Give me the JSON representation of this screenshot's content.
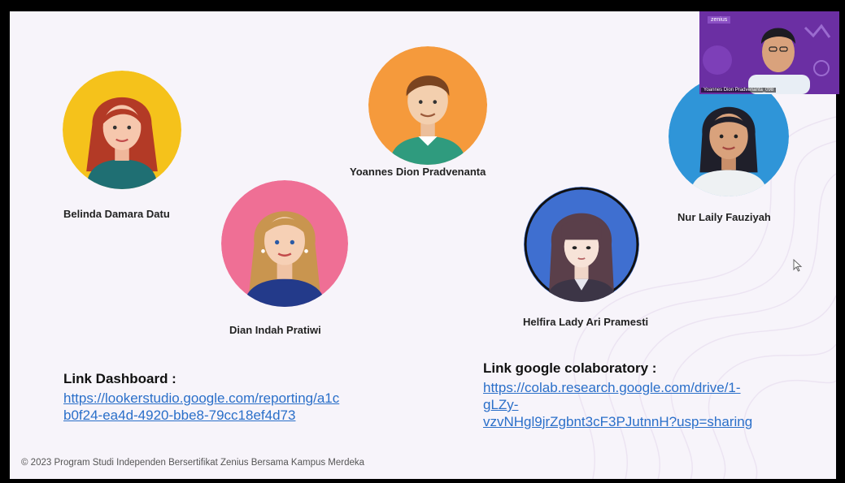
{
  "team": {
    "members": [
      {
        "name": "Belinda Damara Datu"
      },
      {
        "name": "Yoannes Dion Pradvenanta"
      },
      {
        "name": "Nur Laily Fauziyah"
      },
      {
        "name": "Dian Indah Pratiwi"
      },
      {
        "name": "Helfira Lady Ari Pramesti"
      }
    ]
  },
  "links": {
    "dashboard": {
      "title": "Link Dashboard :",
      "url_line1": "https://lookerstudio.google.com/reporting/a1c",
      "url_line2": "b0f24-ea4d-4920-bbe8-79cc18ef4d73"
    },
    "colab": {
      "title": "Link google colaboratory :",
      "url_line1": "https://colab.research.google.com/drive/1-",
      "url_line2": "gLZy-",
      "url_line3": "vzvNHgl9jrZgbnt3cF3PJutnnH?usp=sharing"
    }
  },
  "footer": {
    "text": "© 2023 Program Studi Independen Bersertifikat Zenius Bersama Kampus Merdeka"
  },
  "webcam": {
    "brand": "zenius",
    "caption": "Yoannes Dion Pradvenanta_098"
  },
  "colors": {
    "avatar_yellow": "#f5c21b",
    "avatar_orange": "#f59a3c",
    "avatar_blue": "#2f95d8",
    "avatar_pink": "#ef6f95",
    "avatar_indigo": "#3f6fd0",
    "link": "#2a6fc9"
  }
}
